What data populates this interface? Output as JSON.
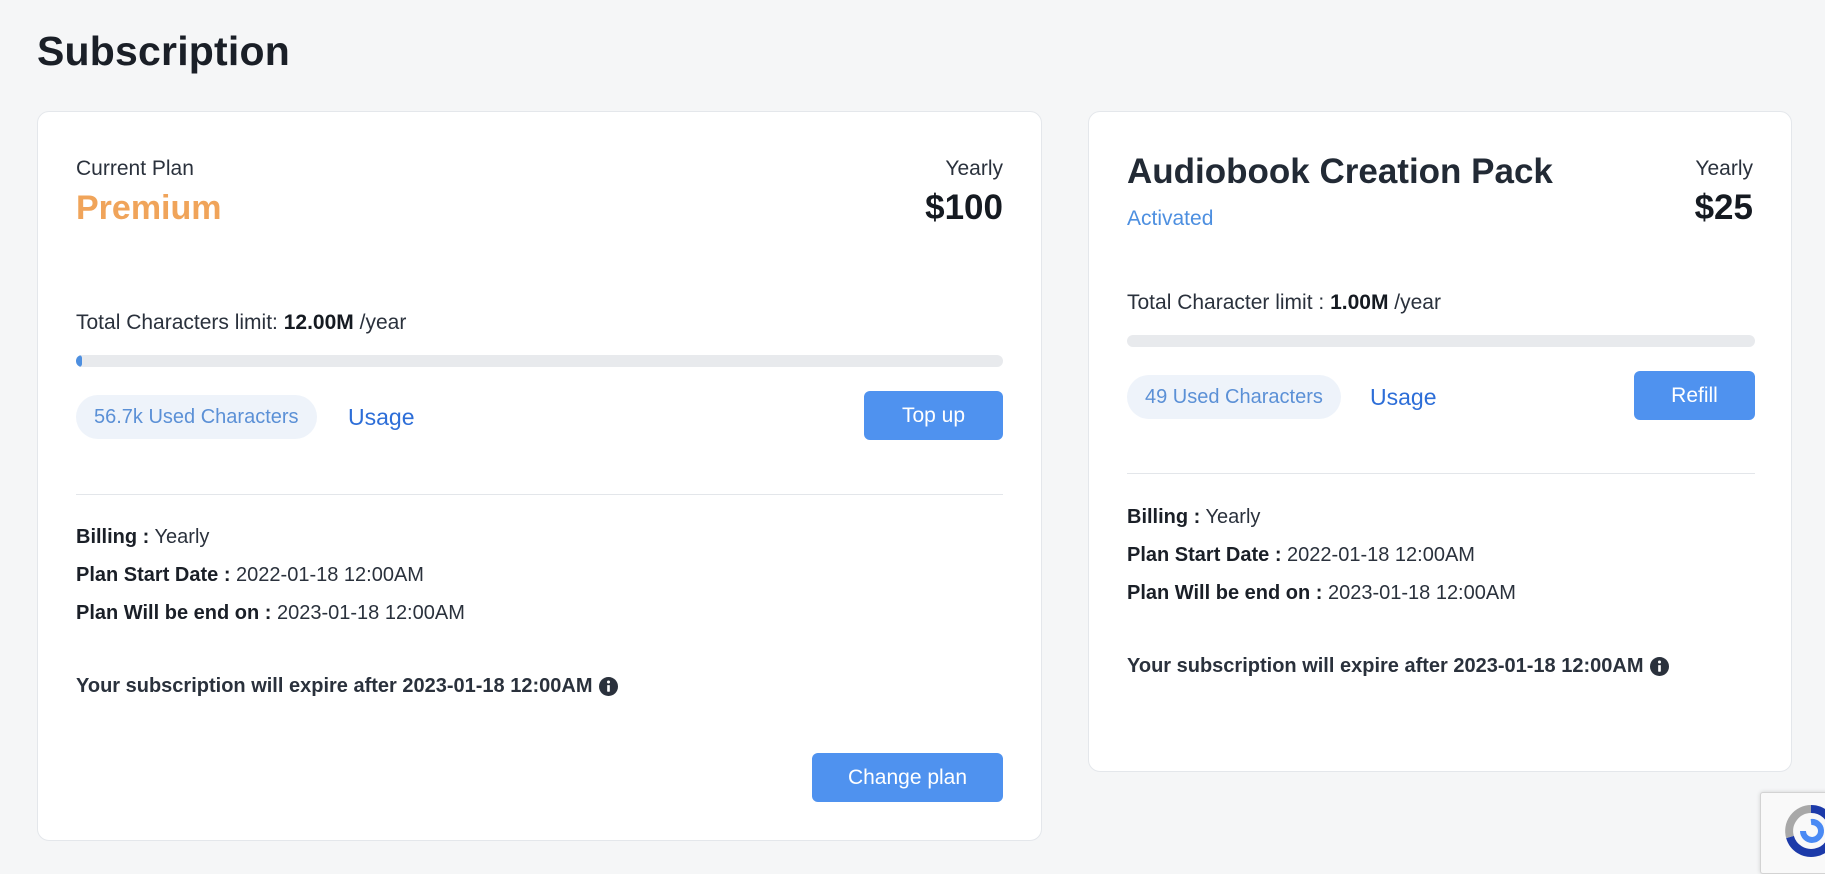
{
  "page": {
    "title": "Subscription"
  },
  "plan_card": {
    "current_plan_label": "Current Plan",
    "plan_name": "Premium",
    "billing_cycle": "Yearly",
    "price": "$100",
    "limit": {
      "label": "Total Characters limit:",
      "value": "12.00M",
      "unit": "/year"
    },
    "usage_fraction": 0.005,
    "used_characters": "56.7k Used Characters",
    "usage_link": "Usage",
    "top_up_label": "Top up",
    "details": [
      {
        "label": "Billing :",
        "value": "Yearly"
      },
      {
        "label": "Plan Start Date :",
        "value": "2022-01-18 12:00AM"
      },
      {
        "label": "Plan Will be end on :",
        "value": "2023-01-18 12:00AM"
      }
    ],
    "expire_text": "Your subscription will expire after 2023-01-18 12:00AM",
    "change_plan_label": "Change plan"
  },
  "pack_card": {
    "title": "Audiobook Creation Pack",
    "status": "Activated",
    "billing_cycle": "Yearly",
    "price": "$25",
    "limit": {
      "label": "Total Character limit :",
      "value": "1.00M",
      "unit": "/year"
    },
    "usage_fraction": 0.0,
    "used_characters": "49 Used Characters",
    "usage_link": "Usage",
    "refill_label": "Refill",
    "details": [
      {
        "label": "Billing :",
        "value": "Yearly"
      },
      {
        "label": "Plan Start Date :",
        "value": "2022-01-18 12:00AM"
      },
      {
        "label": "Plan Will be end on :",
        "value": "2023-01-18 12:00AM"
      }
    ],
    "expire_text": "Your subscription will expire after 2023-01-18 12:00AM"
  },
  "colors": {
    "accent": "#4f92ef",
    "premium": "#f0a45a",
    "link": "#2d6ed8"
  },
  "icons": {
    "info": "info-circle-icon",
    "recaptcha": "recaptcha-icon"
  }
}
